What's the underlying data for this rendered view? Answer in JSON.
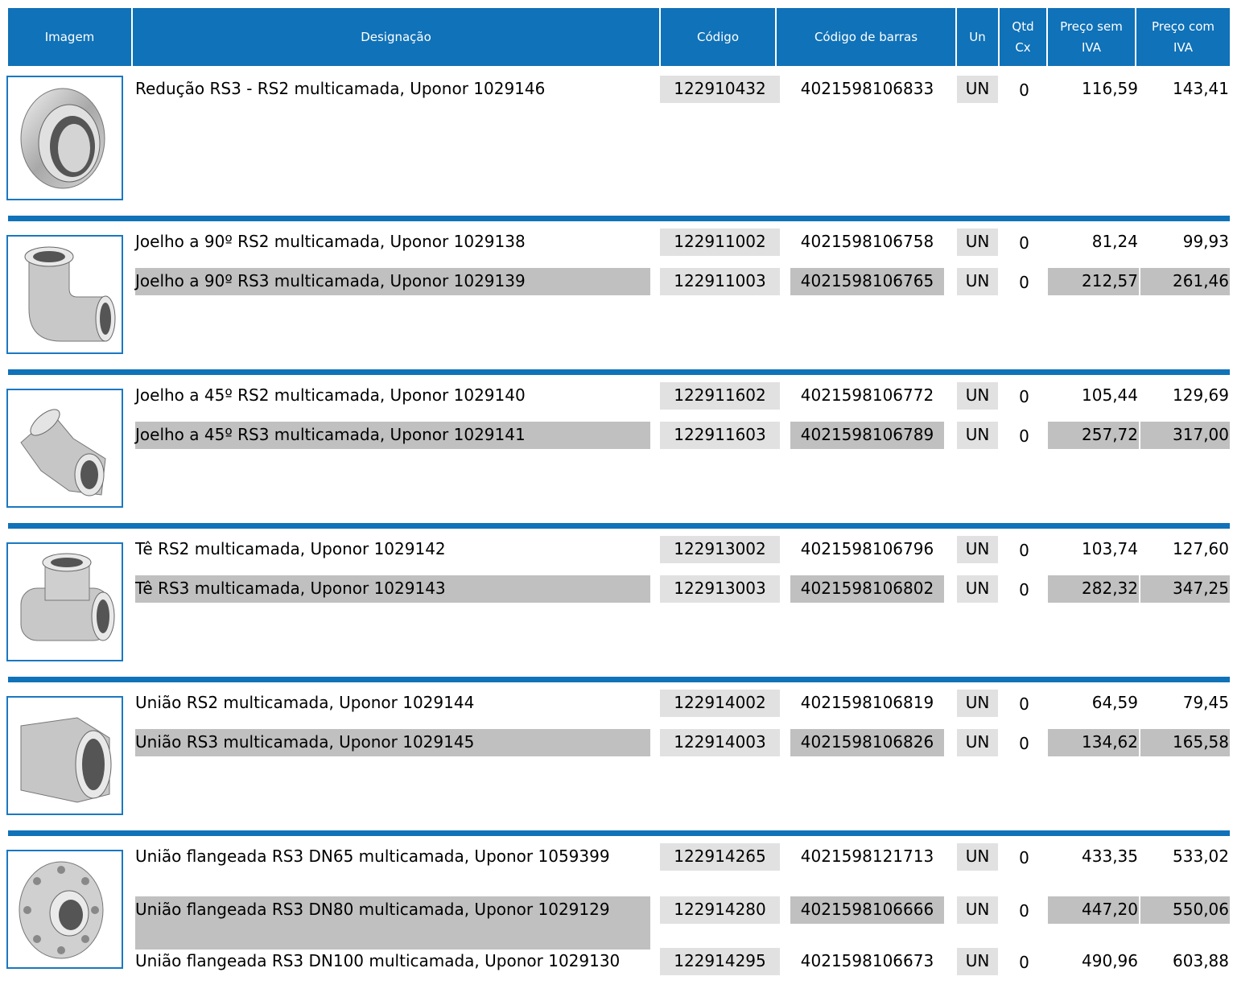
{
  "header": {
    "imagem": "Imagem",
    "designacao": "Designação",
    "codigo": "Código",
    "codigo_barras": "Código de barras",
    "un": "Un",
    "qtd_line1": "Qtd",
    "qtd_line2": "Cx",
    "preco_sem_line1": "Preço sem",
    "preco_sem_line2": "IVA",
    "preco_com_line1": "Preço com",
    "preco_com_line2": "IVA"
  },
  "groups": [
    {
      "image_icon": "reducer-fitting-icon",
      "rows": [
        {
          "designacao": "Redução RS3 - RS2 multicamada, Uponor 1029146",
          "codigo": "122910432",
          "barras": "4021598106833",
          "un": "UN",
          "qtd": "0",
          "preco_sem": "116,59",
          "preco_com": "143,41"
        }
      ]
    },
    {
      "image_icon": "elbow-90-fitting-icon",
      "rows": [
        {
          "designacao": "Joelho a 90º RS2 multicamada, Uponor 1029138",
          "codigo": "122911002",
          "barras": "4021598106758",
          "un": "UN",
          "qtd": "0",
          "preco_sem": "81,24",
          "preco_com": "99,93"
        },
        {
          "designacao": "Joelho a 90º RS3 multicamada, Uponor 1029139",
          "codigo": "122911003",
          "barras": "4021598106765",
          "un": "UN",
          "qtd": "0",
          "preco_sem": "212,57",
          "preco_com": "261,46"
        }
      ]
    },
    {
      "image_icon": "elbow-45-fitting-icon",
      "rows": [
        {
          "designacao": "Joelho a 45º RS2 multicamada, Uponor 1029140",
          "codigo": "122911602",
          "barras": "4021598106772",
          "un": "UN",
          "qtd": "0",
          "preco_sem": "105,44",
          "preco_com": "129,69"
        },
        {
          "designacao": "Joelho a 45º RS3 multicamada, Uponor 1029141",
          "codigo": "122911603",
          "barras": "4021598106789",
          "un": "UN",
          "qtd": "0",
          "preco_sem": "257,72",
          "preco_com": "317,00"
        }
      ]
    },
    {
      "image_icon": "tee-fitting-icon",
      "rows": [
        {
          "designacao": "Tê RS2 multicamada, Uponor 1029142",
          "codigo": "122913002",
          "barras": "4021598106796",
          "un": "UN",
          "qtd": "0",
          "preco_sem": "103,74",
          "preco_com": "127,60"
        },
        {
          "designacao": "Tê RS3 multicamada, Uponor 1029143",
          "codigo": "122913003",
          "barras": "4021598106802",
          "un": "UN",
          "qtd": "0",
          "preco_sem": "282,32",
          "preco_com": "347,25"
        }
      ]
    },
    {
      "image_icon": "union-fitting-icon",
      "rows": [
        {
          "designacao": "União RS2 multicamada, Uponor 1029144",
          "codigo": "122914002",
          "barras": "4021598106819",
          "un": "UN",
          "qtd": "0",
          "preco_sem": "64,59",
          "preco_com": "79,45"
        },
        {
          "designacao": "União RS3 multicamada, Uponor 1029145",
          "codigo": "122914003",
          "barras": "4021598106826",
          "un": "UN",
          "qtd": "0",
          "preco_sem": "134,62",
          "preco_com": "165,58"
        }
      ]
    },
    {
      "image_icon": "flanged-union-fitting-icon",
      "rows": [
        {
          "designacao": "União flangeada RS3 DN65 multicamada, Uponor 1059399",
          "codigo": "122914265",
          "barras": "4021598121713",
          "un": "UN",
          "qtd": "0",
          "preco_sem": "433,35",
          "preco_com": "533,02"
        },
        {
          "designacao": "União flangeada RS3 DN80 multicamada, Uponor 1029129",
          "codigo": "122914280",
          "barras": "4021598106666",
          "un": "UN",
          "qtd": "0",
          "preco_sem": "447,20",
          "preco_com": "550,06"
        },
        {
          "designacao": "União flangeada RS3 DN100 multicamada, Uponor 1029130",
          "codigo": "122914295",
          "barras": "4021598106673",
          "un": "UN",
          "qtd": "0",
          "preco_sem": "490,96",
          "preco_com": "603,88"
        }
      ]
    }
  ]
}
